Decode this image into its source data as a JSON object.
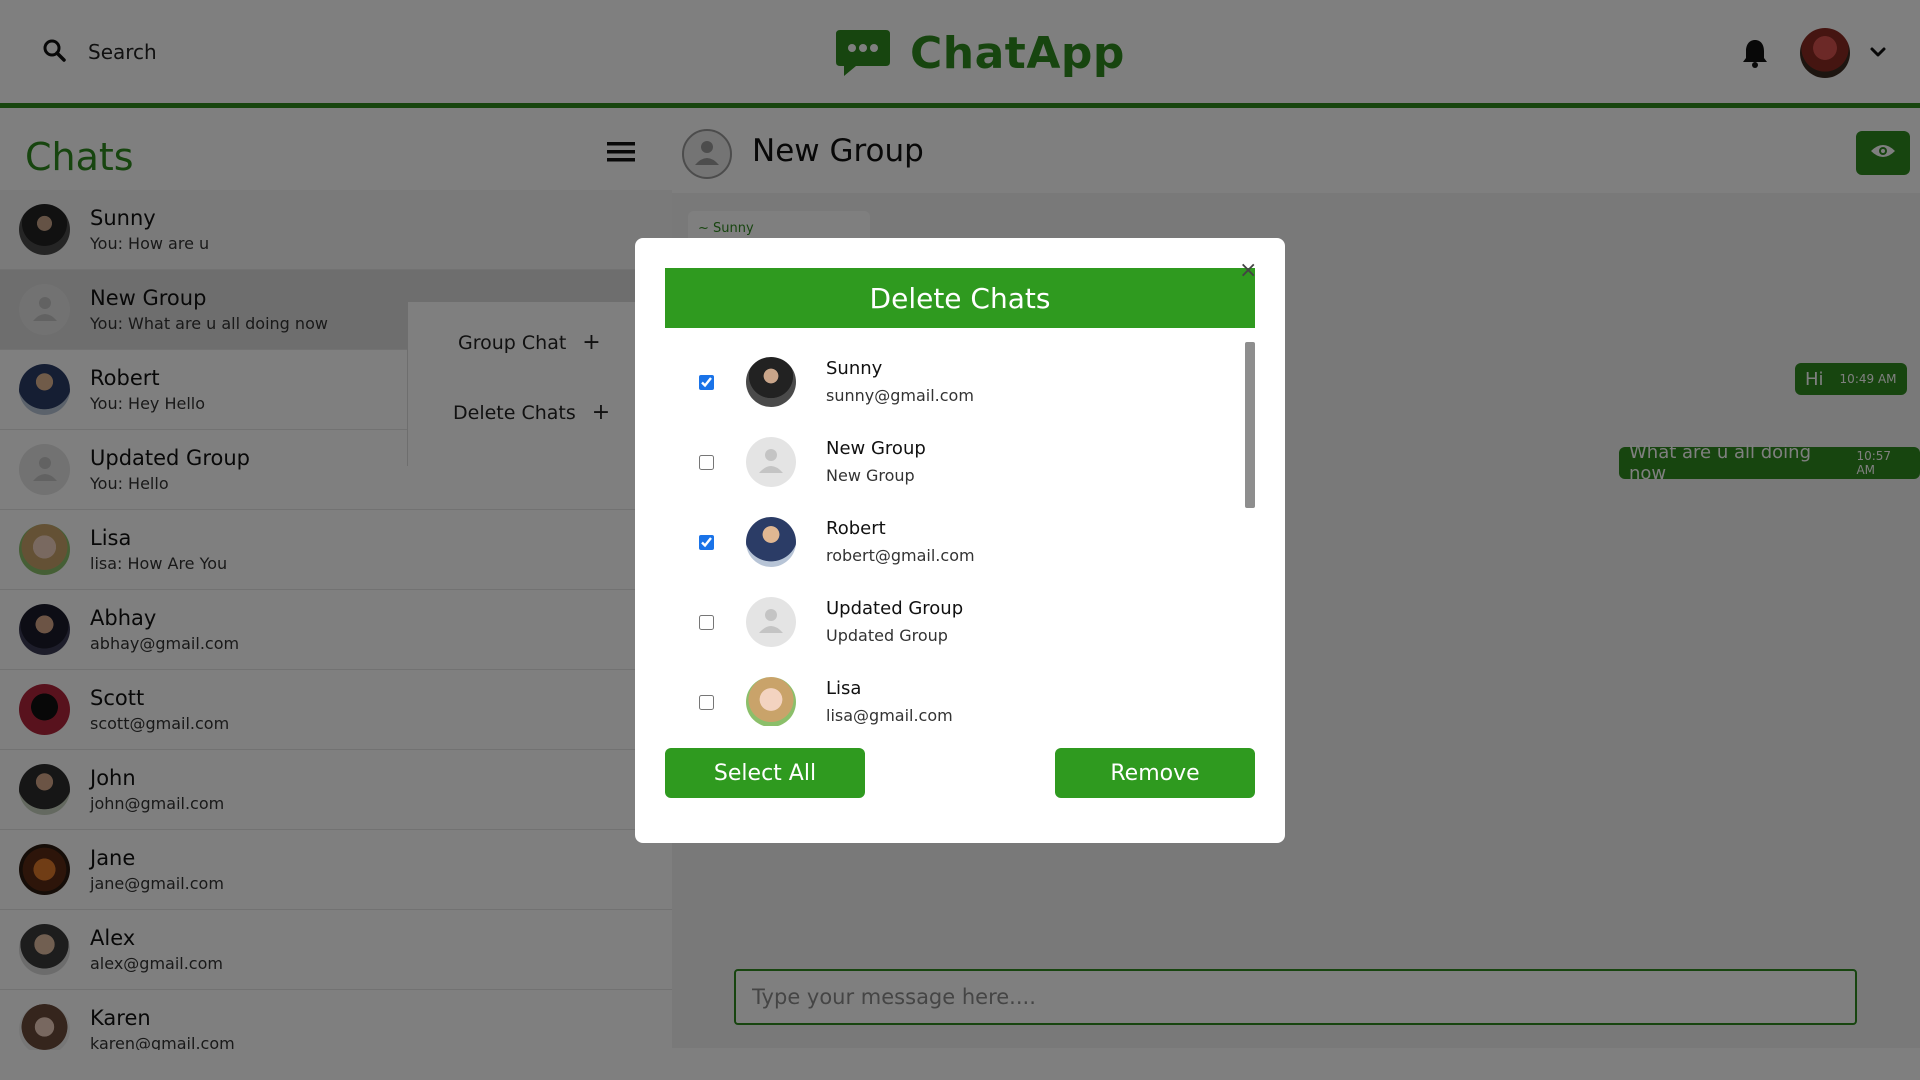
{
  "header": {
    "search_label": "Search",
    "brand_name": "ChatApp"
  },
  "sidebar": {
    "title": "Chats",
    "chats": [
      {
        "name": "Sunny",
        "sub": "You: How are u",
        "avatar": "sunny"
      },
      {
        "name": "New Group",
        "sub": "You: What are u all doing now",
        "avatar": "default"
      },
      {
        "name": "Robert",
        "sub": "You: Hey Hello",
        "avatar": "robert"
      },
      {
        "name": "Updated Group",
        "sub": "You: Hello",
        "avatar": "default"
      },
      {
        "name": "Lisa",
        "sub": "lisa: How Are You",
        "avatar": "lisa"
      },
      {
        "name": "Abhay",
        "sub": "abhay@gmail.com",
        "avatar": "abhay"
      },
      {
        "name": "Scott",
        "sub": "scott@gmail.com",
        "avatar": "scott"
      },
      {
        "name": "John",
        "sub": "john@gmail.com",
        "avatar": "john"
      },
      {
        "name": "Jane",
        "sub": "jane@gmail.com",
        "avatar": "jane"
      },
      {
        "name": "Alex",
        "sub": "alex@gmail.com",
        "avatar": "alex"
      },
      {
        "name": "Karen",
        "sub": "karen@gmail.com",
        "avatar": "karen"
      }
    ],
    "menu": {
      "group_chat": "Group Chat",
      "delete_chats": "Delete Chats",
      "plus": "+"
    }
  },
  "chat": {
    "title": "New Group",
    "incoming": {
      "sender": "~ Sunny"
    },
    "outgoing": [
      {
        "text": "Hi",
        "time": "10:49 AM"
      },
      {
        "text": "What are u all doing now",
        "time": "10:57 AM"
      }
    ],
    "input_placeholder": "Type your message here...."
  },
  "modal": {
    "title": "Delete Chats",
    "close": "×",
    "items": [
      {
        "name": "Sunny",
        "sub": "sunny@gmail.com",
        "checked": true,
        "avatar": "sunny"
      },
      {
        "name": "New Group",
        "sub": "New Group",
        "checked": false,
        "avatar": "default"
      },
      {
        "name": "Robert",
        "sub": "robert@gmail.com",
        "checked": true,
        "avatar": "robert"
      },
      {
        "name": "Updated Group",
        "sub": "Updated Group",
        "checked": false,
        "avatar": "default"
      },
      {
        "name": "Lisa",
        "sub": "lisa@gmail.com",
        "checked": false,
        "avatar": "lisa"
      }
    ],
    "select_all": "Select All",
    "remove": "Remove"
  },
  "colors": {
    "brand_green": "#2f8a1f",
    "button_green": "#2f9a1f",
    "checkbox_blue": "#1a73e8"
  },
  "icons": [
    "search-icon",
    "chat-logo-icon",
    "bell-icon",
    "chevron-down-icon",
    "hamburger-menu-icon",
    "eye-icon",
    "person-placeholder-icon",
    "close-icon"
  ]
}
